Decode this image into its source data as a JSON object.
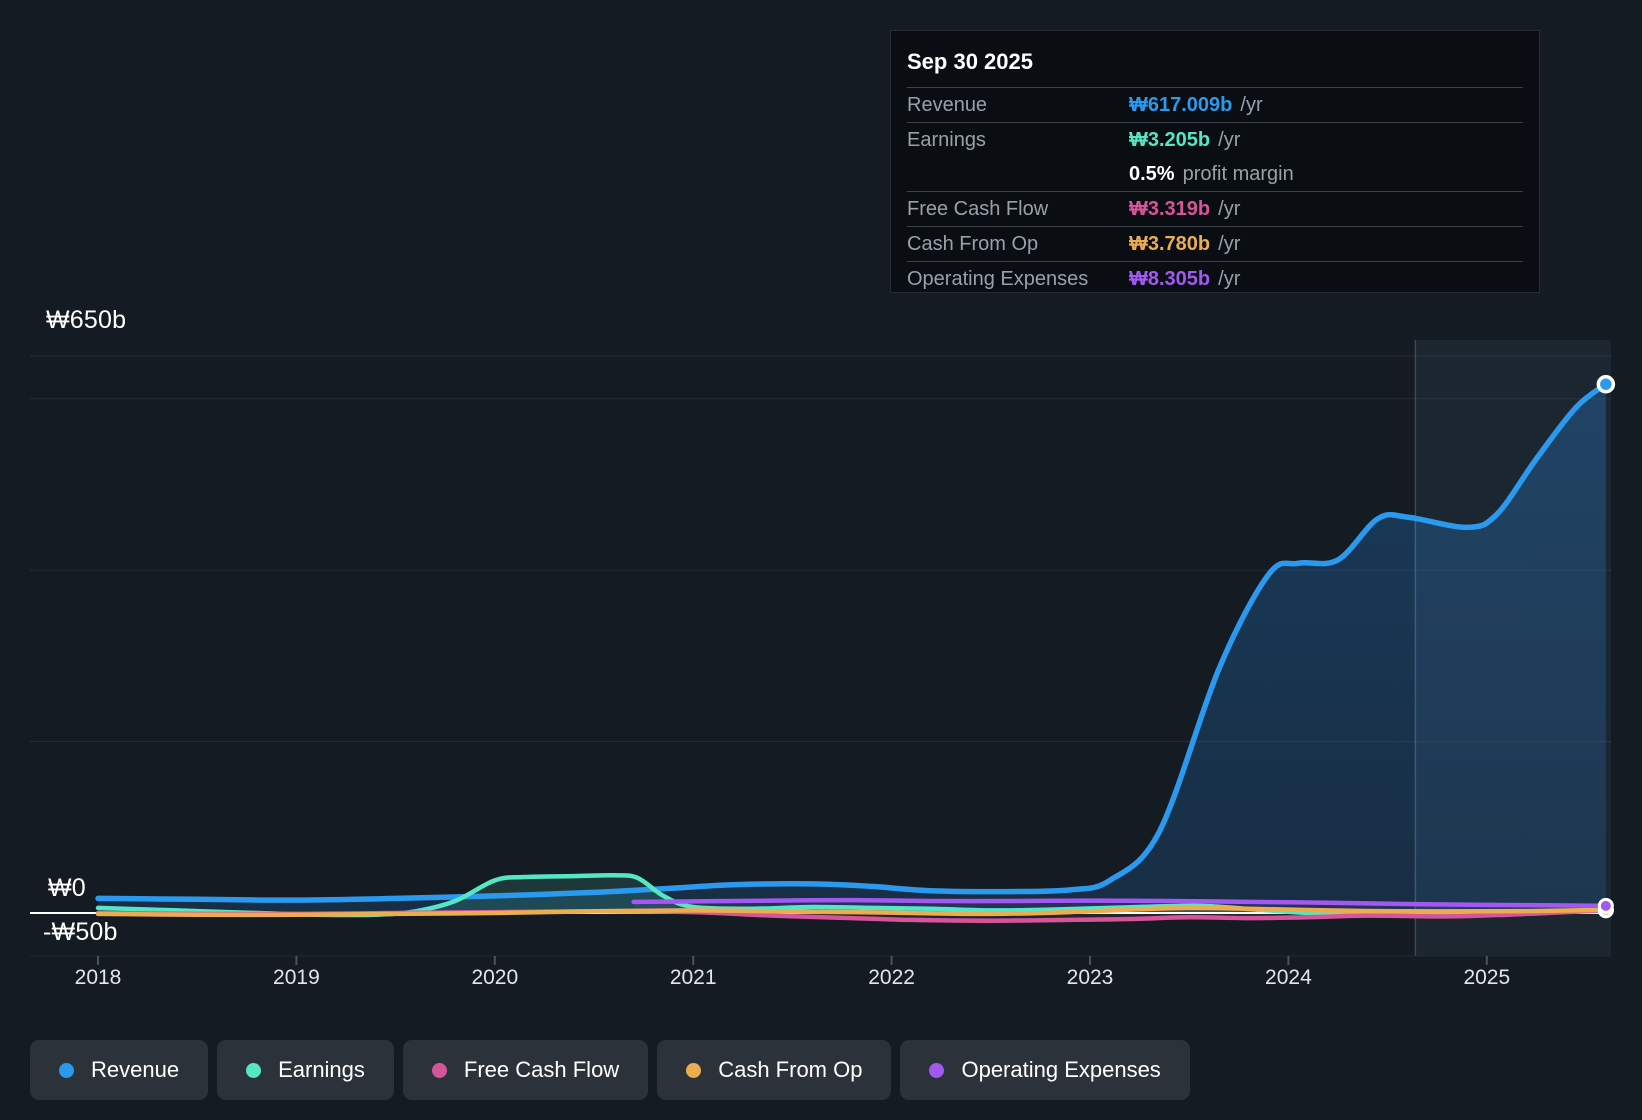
{
  "tooltip": {
    "title": "Sep 30 2025",
    "rows": [
      {
        "label": "Revenue",
        "value": "₩617.009b",
        "suffix": "/yr",
        "color": "#2b99ee"
      },
      {
        "label": "Earnings",
        "value": "₩3.205b",
        "suffix": "/yr",
        "color": "#55e6c4"
      },
      {
        "label": "",
        "value": "0.5%",
        "suffix": "profit margin",
        "color": "#ffffff"
      },
      {
        "label": "Free Cash Flow",
        "value": "₩3.319b",
        "suffix": "/yr",
        "color": "#d6559a"
      },
      {
        "label": "Cash From Op",
        "value": "₩3.780b",
        "suffix": "/yr",
        "color": "#ecac50"
      },
      {
        "label": "Operating Expenses",
        "value": "₩8.305b",
        "suffix": "/yr",
        "color": "#a259f2"
      }
    ]
  },
  "y_axis": {
    "top_label": "₩650b",
    "zero_label": "₩0",
    "bottom_label": "-₩50b"
  },
  "chart_data": {
    "type": "line",
    "unit": "₩ billions per year",
    "x_ticks": [
      "2018",
      "2019",
      "2020",
      "2021",
      "2022",
      "2023",
      "2024",
      "2025"
    ],
    "x_range": [
      2018,
      2025.6
    ],
    "ylim": [
      -50,
      650
    ],
    "y_gridline_values": [
      650,
      600,
      400,
      200
    ],
    "zero_line": 0,
    "highlight_from_year": 2024.64,
    "legend_position": "bottom-left",
    "series": [
      {
        "name": "Revenue",
        "color": "#2b99ee",
        "points": [
          [
            2018,
            17
          ],
          [
            2018.5,
            16
          ],
          [
            2019,
            15
          ],
          [
            2019.5,
            17
          ],
          [
            2020,
            20
          ],
          [
            2020.5,
            24
          ],
          [
            2020.9,
            29
          ],
          [
            2021.2,
            33
          ],
          [
            2021.6,
            34
          ],
          [
            2021.9,
            31
          ],
          [
            2022.2,
            26
          ],
          [
            2022.6,
            25
          ],
          [
            2022.9,
            27
          ],
          [
            2023.1,
            38
          ],
          [
            2023.35,
            95
          ],
          [
            2023.65,
            285
          ],
          [
            2023.9,
            395
          ],
          [
            2024.05,
            408
          ],
          [
            2024.25,
            412
          ],
          [
            2024.45,
            460
          ],
          [
            2024.6,
            462
          ],
          [
            2024.9,
            450
          ],
          [
            2025.05,
            465
          ],
          [
            2025.25,
            530
          ],
          [
            2025.45,
            590
          ],
          [
            2025.6,
            617
          ]
        ]
      },
      {
        "name": "Earnings",
        "color": "#55e6c4",
        "points": [
          [
            2018,
            6
          ],
          [
            2018.4,
            3
          ],
          [
            2018.8,
            0
          ],
          [
            2019.1,
            -2
          ],
          [
            2019.4,
            -2
          ],
          [
            2019.6,
            2
          ],
          [
            2019.8,
            14
          ],
          [
            2020,
            38
          ],
          [
            2020.15,
            42
          ],
          [
            2020.4,
            43
          ],
          [
            2020.6,
            44
          ],
          [
            2020.72,
            41
          ],
          [
            2020.85,
            20
          ],
          [
            2021,
            7
          ],
          [
            2021.3,
            5
          ],
          [
            2021.6,
            7
          ],
          [
            2021.9,
            6
          ],
          [
            2022.2,
            5
          ],
          [
            2022.5,
            3
          ],
          [
            2022.8,
            4
          ],
          [
            2023.1,
            6
          ],
          [
            2023.4,
            8
          ],
          [
            2023.6,
            8
          ],
          [
            2023.9,
            3
          ],
          [
            2024.2,
            -1
          ],
          [
            2024.6,
            -2
          ],
          [
            2025,
            -1
          ],
          [
            2025.3,
            1
          ],
          [
            2025.6,
            3.2
          ]
        ]
      },
      {
        "name": "Free Cash Flow",
        "color": "#d6559a",
        "points": [
          [
            2018,
            0
          ],
          [
            2018.5,
            -1
          ],
          [
            2019,
            -1
          ],
          [
            2019.5,
            0
          ],
          [
            2020,
            1
          ],
          [
            2020.5,
            2
          ],
          [
            2021,
            1
          ],
          [
            2021.4,
            -3
          ],
          [
            2021.8,
            -6
          ],
          [
            2022.1,
            -8
          ],
          [
            2022.5,
            -9
          ],
          [
            2022.9,
            -8
          ],
          [
            2023.2,
            -7
          ],
          [
            2023.5,
            -5
          ],
          [
            2023.8,
            -6
          ],
          [
            2024.1,
            -5
          ],
          [
            2024.4,
            -3
          ],
          [
            2024.8,
            -4
          ],
          [
            2025.1,
            -2
          ],
          [
            2025.35,
            0.5
          ],
          [
            2025.6,
            3.3
          ]
        ]
      },
      {
        "name": "Cash From Op",
        "color": "#ecac50",
        "points": [
          [
            2018,
            -1
          ],
          [
            2018.5,
            -2
          ],
          [
            2019,
            -2
          ],
          [
            2019.5,
            -1
          ],
          [
            2020,
            0
          ],
          [
            2020.5,
            2
          ],
          [
            2021,
            3
          ],
          [
            2021.4,
            2
          ],
          [
            2021.8,
            1
          ],
          [
            2022.1,
            0
          ],
          [
            2022.5,
            -1
          ],
          [
            2022.9,
            1
          ],
          [
            2023.2,
            4
          ],
          [
            2023.5,
            6
          ],
          [
            2023.8,
            5
          ],
          [
            2024.2,
            3
          ],
          [
            2024.6,
            2
          ],
          [
            2025,
            2
          ],
          [
            2025.3,
            2.5
          ],
          [
            2025.6,
            3.8
          ]
        ]
      },
      {
        "name": "Operating Expenses",
        "color": "#a259f2",
        "points": [
          [
            2020.7,
            13
          ],
          [
            2021,
            13.5
          ],
          [
            2021.4,
            14.5
          ],
          [
            2021.8,
            15
          ],
          [
            2022.2,
            14
          ],
          [
            2022.6,
            14
          ],
          [
            2023,
            14.5
          ],
          [
            2023.4,
            14
          ],
          [
            2023.8,
            13
          ],
          [
            2024.2,
            12
          ],
          [
            2024.6,
            10.5
          ],
          [
            2025,
            9.5
          ],
          [
            2025.3,
            9
          ],
          [
            2025.6,
            8.3
          ]
        ]
      }
    ]
  }
}
